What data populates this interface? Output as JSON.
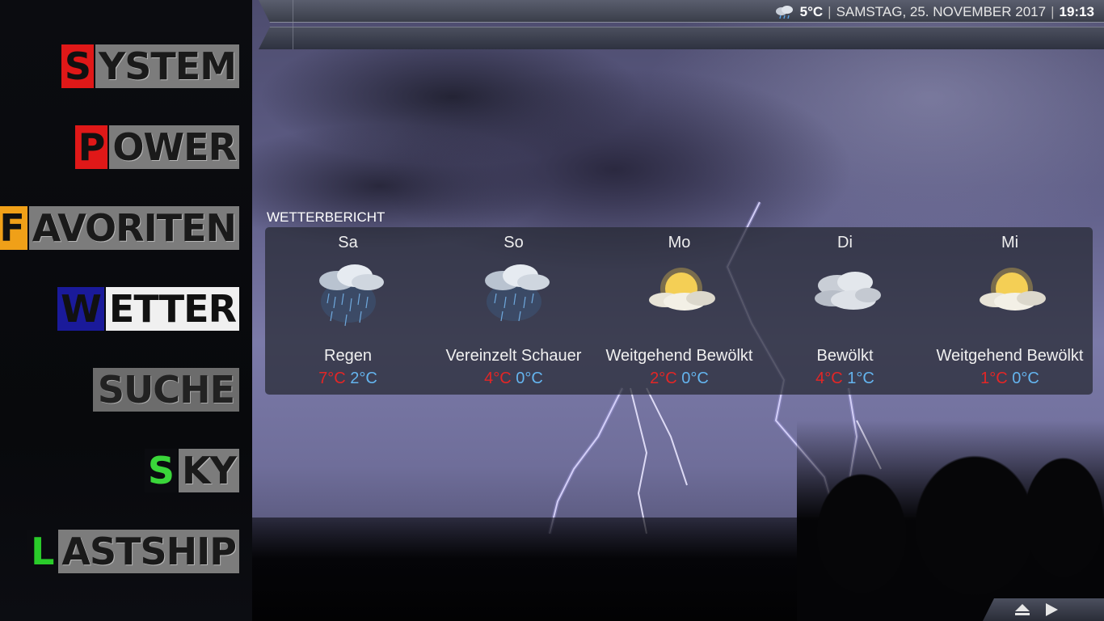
{
  "statusbar": {
    "weather_icon": "rain-cloud-icon",
    "temperature": "5°C",
    "separator": "|",
    "date": "SAMSTAG, 25. NOVEMBER 2017",
    "time": "19:13"
  },
  "menu": {
    "items": [
      {
        "first": "S",
        "rest": "YSTEM",
        "first_color": "#e01818"
      },
      {
        "first": "P",
        "rest": "OWER",
        "first_color": "#e01818"
      },
      {
        "first": "F",
        "rest": "AVORITEN",
        "first_color": "#f0a018"
      },
      {
        "first": "W",
        "rest": "ETTER",
        "first_color": "#1a1a9a"
      },
      {
        "label": "SUCHE"
      },
      {
        "first": "S",
        "rest": "KY",
        "first_color": "#3ad63a"
      },
      {
        "first": "L",
        "rest": "ASTSHIP",
        "first_color": "#2acc2a"
      }
    ]
  },
  "weather": {
    "section_label": "WETTERBERICHT",
    "days": [
      {
        "name": "Sa",
        "icon": "rain-cloud-icon",
        "condition": "Regen",
        "high": "7°C",
        "low": "2°C"
      },
      {
        "name": "So",
        "icon": "showers-cloud-icon",
        "condition": "Vereinzelt Schauer",
        "high": "4°C",
        "low": "0°C"
      },
      {
        "name": "Mo",
        "icon": "partly-cloudy-icon",
        "condition": "Weitgehend Bewölkt",
        "high": "2°C",
        "low": "0°C"
      },
      {
        "name": "Di",
        "icon": "cloudy-icon",
        "condition": "Bewölkt",
        "high": "4°C",
        "low": "1°C"
      },
      {
        "name": "Mi",
        "icon": "partly-cloudy-icon",
        "condition": "Weitgehend Bewölkt",
        "high": "1°C",
        "low": "0°C"
      }
    ]
  },
  "controls": {
    "eject_icon": "eject-icon",
    "play_icon": "play-icon"
  }
}
